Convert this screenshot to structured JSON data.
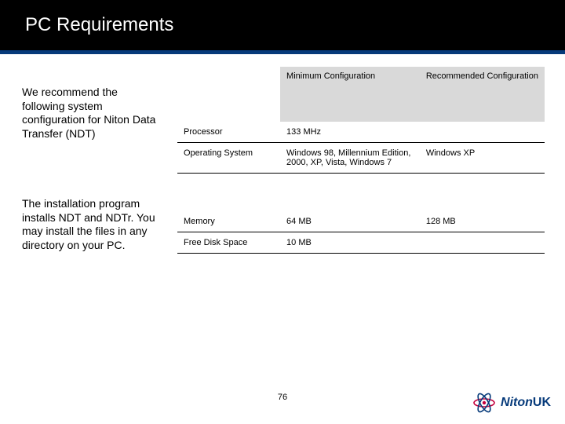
{
  "title": "PC Requirements",
  "left": {
    "para1": "We recommend the following system configuration for Niton Data Transfer (NDT)",
    "para2": "The installation program installs NDT and NDTr. You may install the files in any directory on your PC."
  },
  "table": {
    "headers": {
      "spec": "",
      "min": "Minimum Configuration",
      "rec": "Recommended Configuration"
    },
    "rows": [
      {
        "spec": "Processor",
        "min": "133 MHz",
        "rec": ""
      },
      {
        "spec": "Operating System",
        "min": "Windows 98, Millennium Edition, 2000, XP, Vista, Windows 7",
        "rec": "Windows XP"
      }
    ],
    "rows2": [
      {
        "spec": "Memory",
        "min": "64 MB",
        "rec": "128 MB"
      },
      {
        "spec": "Free Disk Space",
        "min": "10 MB",
        "rec": ""
      }
    ]
  },
  "page_number": "76",
  "logo": {
    "brand": "Niton",
    "suffix": "UK"
  }
}
